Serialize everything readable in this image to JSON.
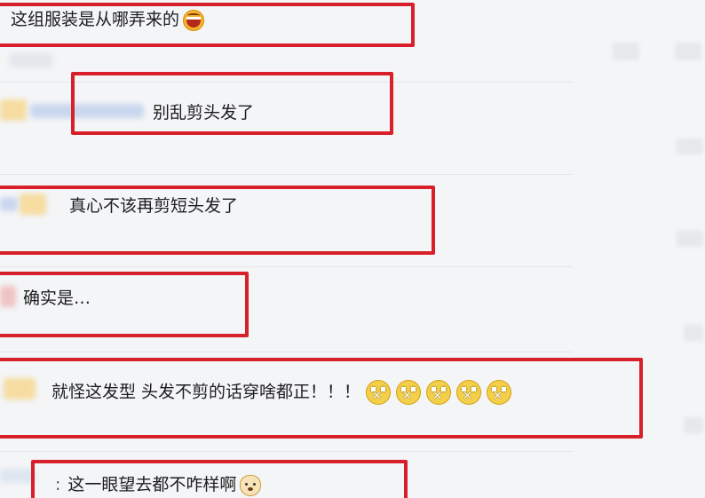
{
  "comments": [
    {
      "text": "这组服装是从哪弄来的",
      "emoji": "laughing-face-icon"
    },
    {
      "text": "别乱剪头发了"
    },
    {
      "text": "真心不该再剪短头发了"
    },
    {
      "text": "确实是…"
    },
    {
      "text": "就怪这发型 头发不剪的话穿啥都正！！！",
      "emoji": "silent-face-icon",
      "emoji_count": 5
    },
    {
      "prefix": ":",
      "text": "这一眼望去都不咋样啊",
      "emoji": "doge-icon"
    }
  ],
  "colors": {
    "annotation_red": "#d8202a",
    "background": "#f4f5f7"
  }
}
